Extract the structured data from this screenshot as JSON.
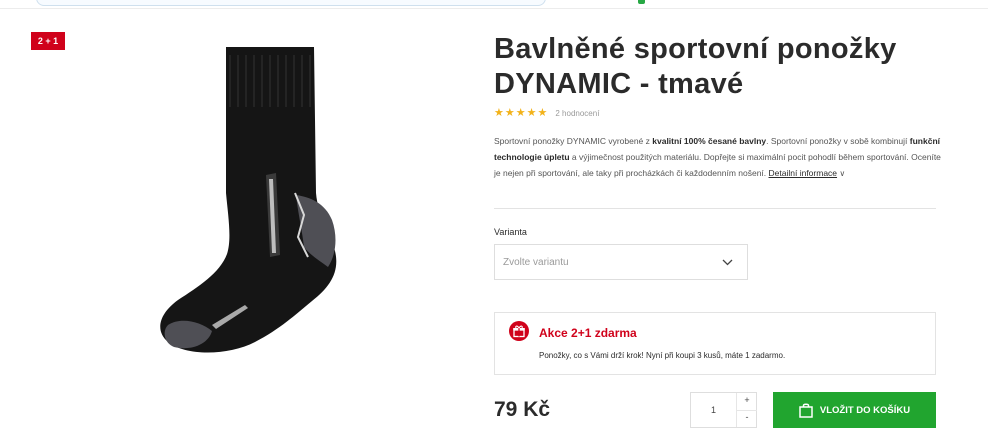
{
  "badge": "2 + 1",
  "product": {
    "title": "Bavlněné sportovní ponožky DYNAMIC - tmavé",
    "rating": {
      "stars": 5,
      "count_text": "2 hodnocení"
    },
    "description": {
      "intro": "Sportovní ponožky DYNAMIC vyrobené z ",
      "bold1": "kvalitní 100% česané bavlny",
      "mid": ". Sportovní ponožky v sobě kombinují ",
      "bold2": "funkční technologie úpletu",
      "outro": " a výjimečnost použitých materiálu. Dopřejte si maximální pocit pohodlí během sportování. Oceníte je nejen při sportování, ale taky při procházkách či každodenním nošení. ",
      "link": "Detailní informace"
    }
  },
  "variant": {
    "label": "Varianta",
    "placeholder": "Zvolte variantu"
  },
  "promo": {
    "title": "Akce 2+1 zdarma",
    "text": "Ponožky, co s Vámi drží krok! Nyní při koupi 3 kusů, máte 1 zadarmo."
  },
  "purchase": {
    "price": "79 Kč",
    "quantity": "1",
    "plus": "+",
    "minus": "-",
    "add_label": "VLOŽIT DO KOŠÍKU"
  },
  "colors": {
    "badge_red": "#d0021b",
    "cta_green": "#21a52f",
    "star": "#f2b21a"
  }
}
